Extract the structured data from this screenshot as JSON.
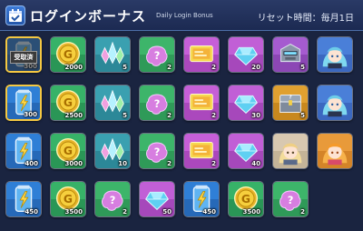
{
  "header": {
    "title": "ログインボーナス",
    "subtitle": "Daily Login Bonus",
    "reset_text": "リセット時間：毎月1日"
  },
  "claimed_label": "受取済",
  "rows": [
    [
      {
        "icon": "energy-can-icon",
        "qty": "300",
        "claimed": true
      },
      {
        "icon": "gold-coin-icon",
        "qty": "2000"
      },
      {
        "icon": "crystal-cluster-icon",
        "qty": "5"
      },
      {
        "icon": "mystery-blob-icon",
        "qty": "2"
      },
      {
        "icon": "ticket-icon",
        "qty": "2"
      },
      {
        "icon": "gem-icon",
        "qty": "20"
      },
      {
        "icon": "mecha-head-icon",
        "qty": "5"
      },
      {
        "icon": "blue-hair-character-icon",
        "qty": ""
      }
    ],
    [
      {
        "icon": "energy-can-icon",
        "qty": "300",
        "today": true
      },
      {
        "icon": "gold-coin-icon",
        "qty": "2500"
      },
      {
        "icon": "crystal-cluster-icon",
        "qty": "5"
      },
      {
        "icon": "mystery-blob-icon",
        "qty": "2"
      },
      {
        "icon": "ticket-icon",
        "qty": "2"
      },
      {
        "icon": "gem-icon",
        "qty": "30"
      },
      {
        "icon": "treasure-chest-icon",
        "qty": "5"
      },
      {
        "icon": "blue-hair-character-icon",
        "qty": ""
      }
    ],
    [
      {
        "icon": "energy-can-icon",
        "qty": "400"
      },
      {
        "icon": "gold-coin-icon",
        "qty": "3000"
      },
      {
        "icon": "crystal-cluster-icon",
        "qty": "10"
      },
      {
        "icon": "mystery-blob-icon",
        "qty": "2"
      },
      {
        "icon": "ticket-icon",
        "qty": "2"
      },
      {
        "icon": "gem-icon",
        "qty": "40"
      },
      {
        "icon": "blonde-character-icon",
        "qty": ""
      },
      {
        "icon": "orange-hair-character-icon",
        "qty": ""
      }
    ],
    [
      {
        "icon": "energy-can-icon",
        "qty": "450"
      },
      {
        "icon": "gold-coin-icon",
        "qty": "3500"
      },
      {
        "icon": "mystery-blob-icon",
        "qty": "2"
      },
      {
        "icon": "gem-icon",
        "qty": "50"
      },
      {
        "icon": "energy-can-icon",
        "qty": "450"
      },
      {
        "icon": "gold-coin-icon",
        "qty": "3500"
      },
      {
        "icon": "mystery-blob-icon",
        "qty": "2"
      }
    ]
  ]
}
